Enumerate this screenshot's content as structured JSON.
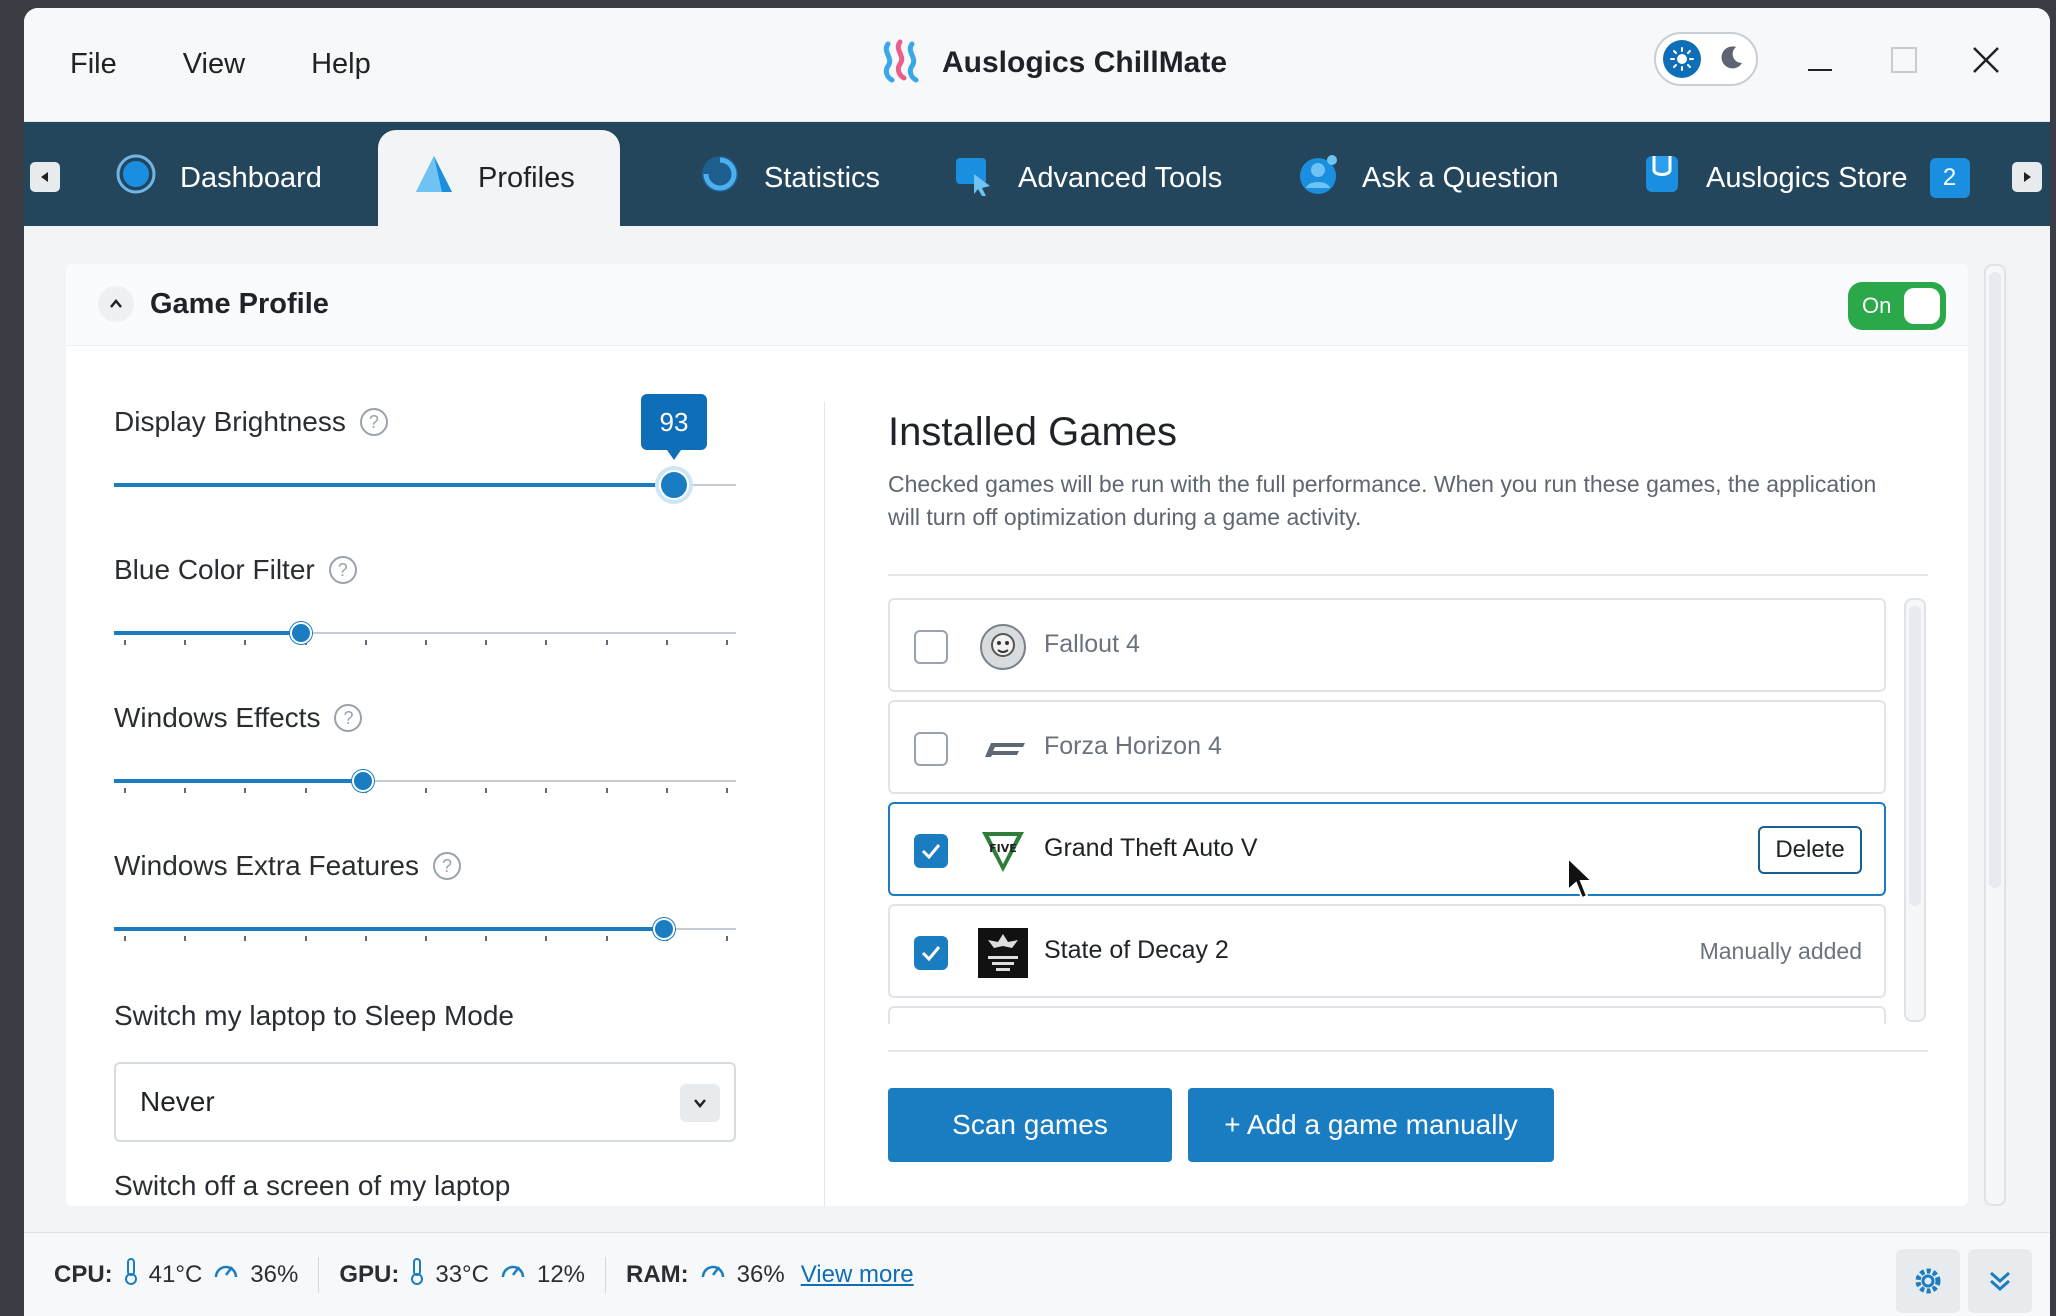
{
  "menu": {
    "file": "File",
    "view": "View",
    "help": "Help"
  },
  "app": {
    "title": "Auslogics ChillMate"
  },
  "tabs": [
    {
      "label": "Dashboard"
    },
    {
      "label": "Profiles"
    },
    {
      "label": "Statistics"
    },
    {
      "label": "Advanced Tools"
    },
    {
      "label": "Ask a Question"
    },
    {
      "label": "Auslogics Store",
      "badge": "2"
    }
  ],
  "profile": {
    "title": "Game Profile",
    "toggle_label": "On",
    "settings": {
      "display_brightness": {
        "label": "Display Brightness",
        "help": "?",
        "value": "93",
        "fraction": 0.9
      },
      "blue_filter": {
        "label": "Blue Color Filter",
        "help": "?",
        "fraction": 0.3
      },
      "windows_effects": {
        "label": "Windows Effects",
        "help": "?",
        "fraction": 0.4
      },
      "windows_extra": {
        "label": "Windows Extra Features",
        "help": "?",
        "fraction": 0.885
      }
    },
    "sleep": {
      "label": "Switch my laptop to Sleep Mode",
      "value": "Never"
    },
    "screen_off": {
      "label": "Switch off a screen of my laptop"
    }
  },
  "games": {
    "title": "Installed Games",
    "description": "Checked games will be run with the full performance. When you run these games, the application will turn off optimization during a game activity.",
    "items": [
      {
        "name": "Fallout 4",
        "checked": false
      },
      {
        "name": "Forza Horizon 4",
        "checked": false
      },
      {
        "name": "Grand Theft Auto V",
        "checked": true,
        "action": "Delete"
      },
      {
        "name": "State of Decay 2",
        "checked": true,
        "tag": "Manually added"
      }
    ],
    "scan_button": "Scan games",
    "add_button": "+ Add a game manually"
  },
  "status": {
    "cpu_label": "CPU:",
    "cpu_temp": "41°C",
    "cpu_load": "36%",
    "gpu_label": "GPU:",
    "gpu_temp": "33°C",
    "gpu_load": "12%",
    "ram_label": "RAM:",
    "ram_load": "36%",
    "view_more": "View more"
  },
  "colors": {
    "accent": "#1a7dc2",
    "tabbar": "#24465c",
    "toggle_on": "#2aa84a"
  }
}
